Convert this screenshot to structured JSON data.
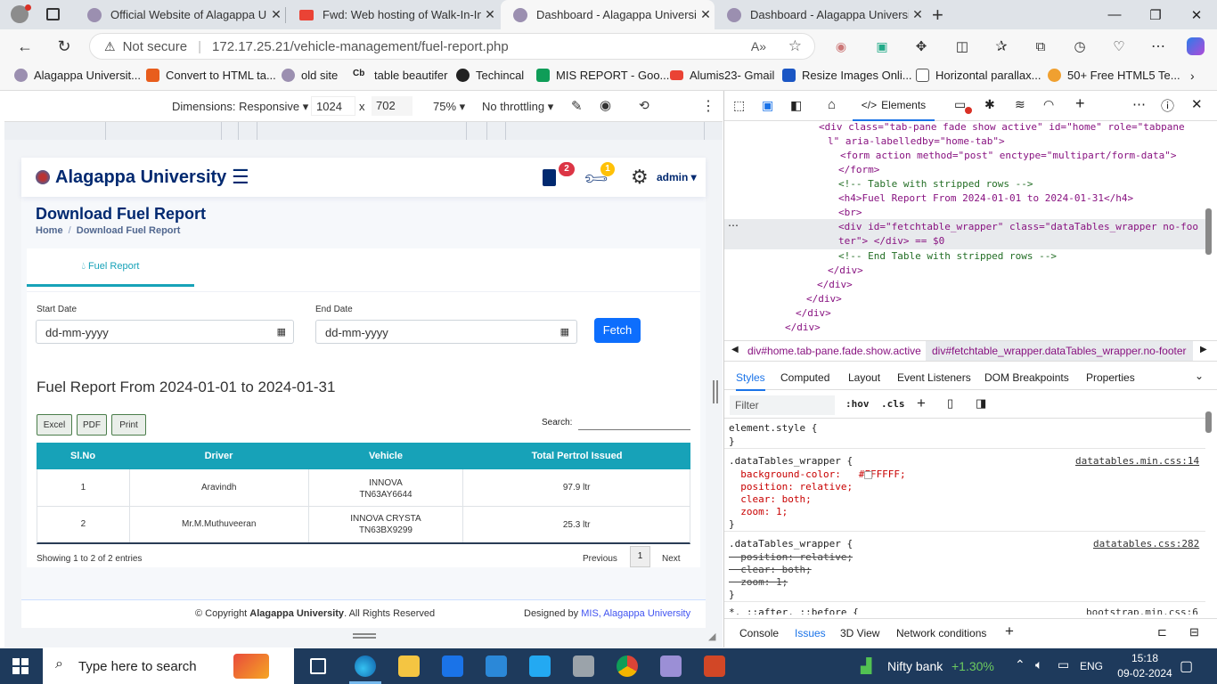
{
  "browser": {
    "tabs": [
      {
        "title": "Official Website of Alagappa Uni"
      },
      {
        "title": "Fwd: Web hosting of Walk-In-Int"
      },
      {
        "title": "Dashboard - Alagappa University"
      },
      {
        "title": "Dashboard - Alagappa University"
      }
    ],
    "security_label": "Not secure",
    "url": "172.17.25.21/vehicle-management/fuel-report.php",
    "bookmarks": [
      "Alagappa Universit...",
      "Convert to HTML ta...",
      "old site",
      "table beautifer",
      "Techincal",
      "MIS REPORT - Goo...",
      "Alumis23- Gmail",
      "Resize Images Onli...",
      "Horizontal parallax...",
      "50+ Free HTML5 Te..."
    ]
  },
  "device_toolbar": {
    "dimensions": "Dimensions: Responsive",
    "width": "1024",
    "x": "x",
    "height": "702",
    "zoom": "75%",
    "throttle": "No throttling"
  },
  "app": {
    "brand": "Alagappa University",
    "doc_badge": "2",
    "tool_badge": "1",
    "user": "admin",
    "page_title": "Download Fuel Report",
    "breadcrumb": {
      "home": "Home",
      "sep": "/",
      "current": "Download Fuel Report"
    },
    "tab_label": "Fuel Report",
    "start_label": "Start Date",
    "start_value": "dd-mm-yyyy",
    "end_label": "End Date",
    "end_value": "dd-mm-yyyy",
    "fetch": "Fetch",
    "report_heading": "Fuel Report From 2024-01-01 to 2024-01-31",
    "buttons": {
      "excel": "Excel",
      "pdf": "PDF",
      "print": "Print"
    },
    "search_label": "Search:",
    "columns": [
      "Sl.No",
      "Driver",
      "Vehicle",
      "Total Pertrol Issued"
    ],
    "rows": [
      {
        "no": "1",
        "driver": "Aravindh",
        "vehicle": "INNOVA",
        "reg": "TN63AY6644",
        "total": "97.9 ltr"
      },
      {
        "no": "2",
        "driver": "Mr.M.Muthuveeran",
        "vehicle": "INNOVA CRYSTA",
        "reg": "TN63BX9299",
        "total": "25.3 ltr"
      }
    ],
    "showing": "Showing 1 to 2 of 2 entries",
    "prev": "Previous",
    "page_num": "1",
    "next": "Next",
    "footer_copyright_pre": "© Copyright ",
    "footer_copyright_brand": "Alagappa University",
    "footer_copyright_post": ". All Rights Reserved",
    "footer_designed_pre": "Designed by ",
    "footer_designed_link": "MIS, Alagappa University"
  },
  "devtools": {
    "elements_tab": "Elements",
    "dom_lines": [
      "<div class=\"tab-pane fade show active\" id=\"home\" role=\"tabpane",
      "l\" aria-labelledby=\"home-tab\">",
      "<form action method=\"post\" enctype=\"multipart/form-data\">",
      "</form>",
      "<!-- Table with stripped rows -->",
      "<h4>Fuel Report From 2024-01-01 to 2024-01-31</h4>",
      "<br>",
      "<div id=\"fetchtable_wrapper\" class=\"dataTables_wrapper no-foo",
      "ter\"> </div> == $0",
      "<!-- End Table with stripped rows -->",
      "</div>",
      "</div>",
      "</div>",
      "</div>",
      "</div>"
    ],
    "crumbs": [
      "div#home.tab-pane.fade.show.active",
      "div#fetchtable_wrapper.dataTables_wrapper.no-footer"
    ],
    "panes": [
      "Styles",
      "Computed",
      "Layout",
      "Event Listeners",
      "DOM Breakpoints",
      "Properties"
    ],
    "filter_placeholder": "Filter",
    "hov": ":hov",
    "cls": ".cls",
    "css_lines": [
      "element.style {",
      "}",
      ".dataTables_wrapper {",
      "  background-color:   #FFFFFF;",
      "  position: relative;",
      "  clear: both;",
      "  zoom: 1;",
      "}",
      ".dataTables_wrapper {",
      "  position: relative;",
      "  clear: both;",
      "  zoom: 1;",
      "}",
      "*, ::after, ::before {"
    ],
    "css_sources": [
      "datatables.min.css:14",
      "datatables.css:282",
      "bootstrap.min.css:6"
    ],
    "drawer_tabs": [
      "Console",
      "Issues",
      "3D View",
      "Network conditions"
    ]
  },
  "taskbar": {
    "search_placeholder": "Type here to search",
    "stock_name": "Nifty bank",
    "stock_change": "+1.30%",
    "lang": "ENG",
    "time": "15:18",
    "date": "09-02-2024"
  },
  "colors": {
    "teal": "#17a2b8",
    "navy": "#012970",
    "primary": "#0d6efd"
  }
}
